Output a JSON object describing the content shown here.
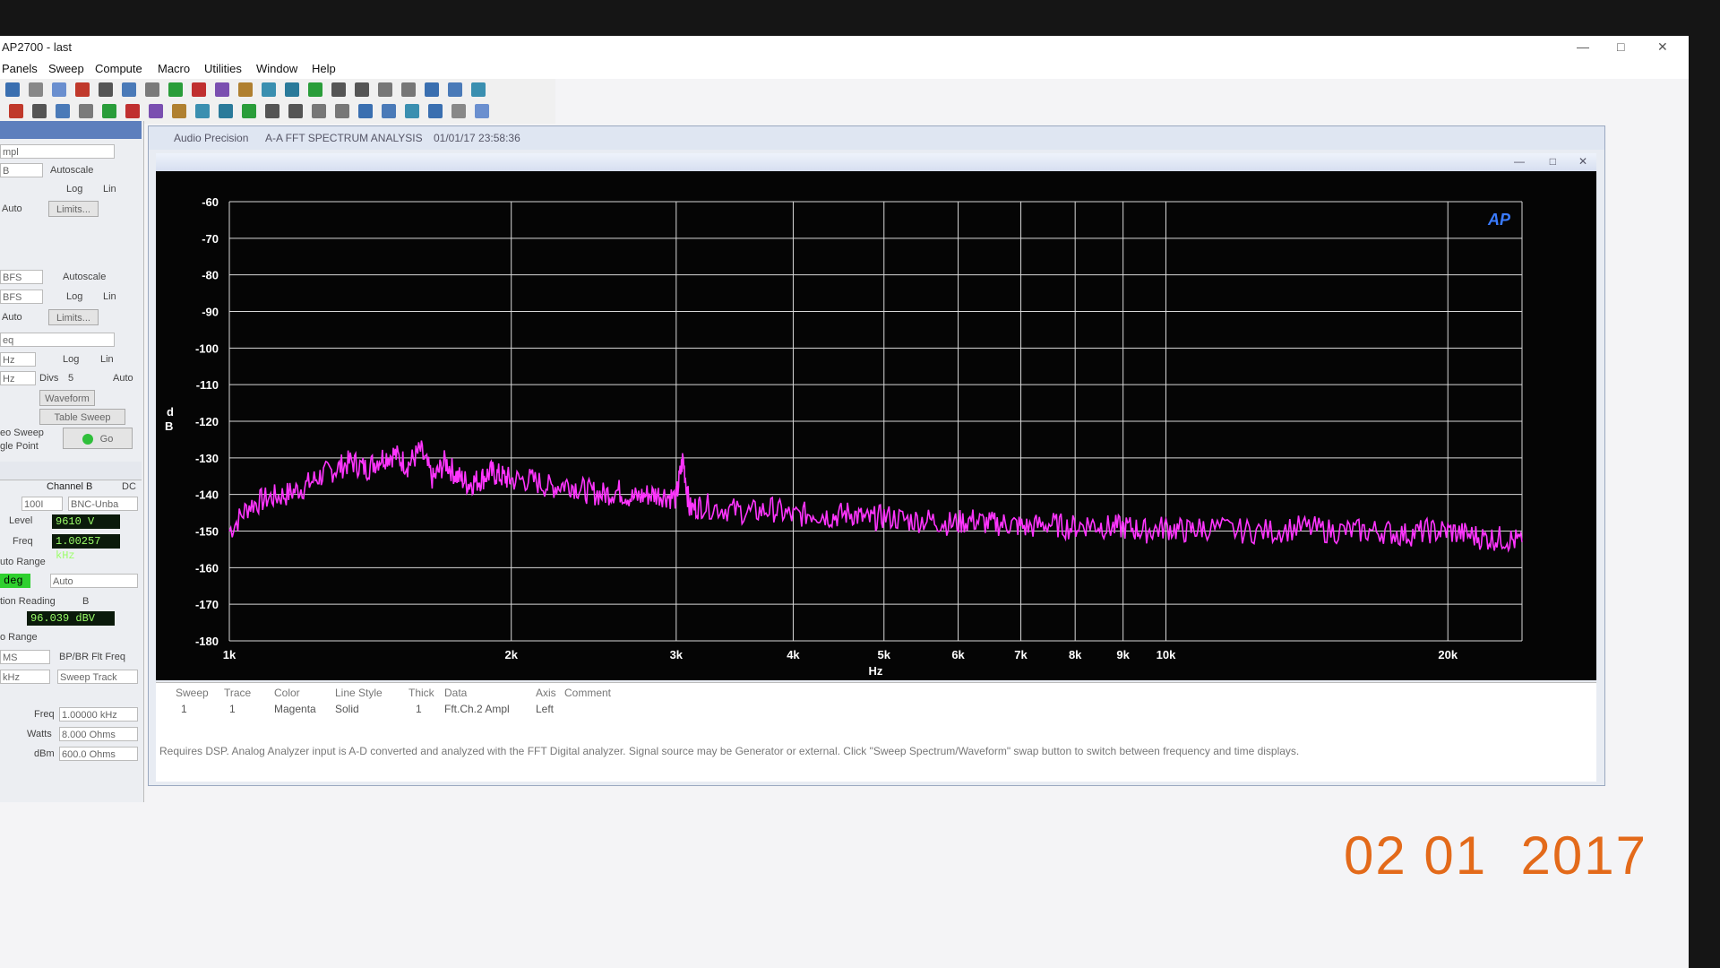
{
  "app": {
    "title": "AP2700 - last",
    "minimize": "—",
    "restore": "□",
    "close": "✕"
  },
  "menu": [
    "Panels",
    "Sweep",
    "Compute",
    "Macro",
    "Utilities",
    "Window",
    "Help"
  ],
  "toolbar_icons": [
    "open-icon",
    "print-icon",
    "print-preview-icon",
    "undo-icon",
    "cut-icon",
    "copy-icon",
    "paste-icon",
    "go-icon",
    "stop-icon",
    "settings-icon",
    "zoom-icon",
    "zoom-fit-icon",
    "refresh-icon",
    "play-icon",
    "pause-icon",
    "stop-square-icon",
    "hand-icon",
    "link-icon",
    "export-icon",
    "window-icon",
    "window2-icon"
  ],
  "left_panel": {
    "ampl": "mpl",
    "autoscale": "Autoscale",
    "unit1": "B",
    "log": "Log",
    "lin": "Lin",
    "auto": "Auto",
    "limits": "Limits...",
    "unit2": "BFS",
    "unit3": "BFS",
    "freq_field": "eq",
    "hz1": "Hz",
    "hz2": "Hz",
    "divs": "Divs",
    "divs_val": "5",
    "auto2": "Auto",
    "waveform": "Waveform",
    "table_sweep": "Table Sweep",
    "stereo_sweep": "eo Sweep",
    "single_point": "gle Point",
    "go": "Go",
    "channel_b": "Channel B",
    "dc": "DC",
    "range": "100I",
    "bnc": "BNC-Unba",
    "level_label": "Level",
    "level_val": "9610  V",
    "freq_label": "Freq",
    "freq_val": "1.00257 kHz",
    "auto_range": "uto Range",
    "deg_val": "deg",
    "auto3": "Auto",
    "function_reading": "tion Reading",
    "b": "B",
    "reading_val": "96.039  dBV",
    "o_range": "o Range",
    "ms": "MS",
    "bpbr": "BP/BR Flt Freq",
    "khz": "kHz",
    "sweep_track": "Sweep Track",
    "freq2_label": "Freq",
    "freq2_val": "1.00000 kHz",
    "watts_label": "Watts",
    "watts_val": "8.000   Ohms",
    "dbm_label": "dBm",
    "dbm_val": "600.0   Ohms"
  },
  "graph_window": {
    "title": "Audio Precision",
    "subtitle": "A-A FFT SPECTRUM ANALYSIS",
    "timestamp": "01/01/17 23:58:36",
    "logo": "AP"
  },
  "chart_data": {
    "type": "line",
    "title": "",
    "xlabel": "Hz",
    "ylabel": "dB",
    "xscale": "log",
    "xlim": [
      1000,
      24000
    ],
    "ylim": [
      -180,
      -60
    ],
    "grid": true,
    "x_ticks": [
      "1k",
      "2k",
      "3k",
      "4k",
      "5k",
      "6k",
      "7k",
      "8k",
      "9k",
      "10k",
      "20k"
    ],
    "y_ticks": [
      "-60",
      "-70",
      "-80",
      "-90",
      "-100",
      "-110",
      "-120",
      "-130",
      "-140",
      "-150",
      "-160",
      "-170",
      "-180"
    ],
    "series": [
      {
        "color": "#ff35ff",
        "x": [
          1000,
          1050,
          1100,
          1150,
          1200,
          1250,
          1300,
          1350,
          1400,
          1450,
          1500,
          1550,
          1600,
          1650,
          1700,
          1750,
          1800,
          1850,
          1900,
          1950,
          2000,
          2100,
          2200,
          2300,
          2400,
          2500,
          2600,
          2700,
          2800,
          2900,
          3000,
          3050,
          3100,
          3200,
          3400,
          3600,
          3800,
          4000,
          4200,
          4400,
          4600,
          4800,
          5000,
          5300,
          5600,
          5900,
          6200,
          6500,
          6800,
          7100,
          7500,
          7900,
          8300,
          8700,
          9100,
          9500,
          10000,
          10500,
          11000,
          12000,
          13000,
          14000,
          15000,
          16000,
          17000,
          18000,
          19000,
          20000,
          21000,
          22000,
          23000,
          24000
        ],
        "values": [
          -150,
          -143,
          -141,
          -140,
          -138,
          -135,
          -133,
          -131,
          -133,
          -130,
          -129,
          -132,
          -128,
          -136,
          -131,
          -135,
          -137,
          -136,
          -134,
          -135,
          -136,
          -136,
          -138,
          -137,
          -139,
          -140,
          -139,
          -141,
          -140,
          -140,
          -141,
          -130,
          -144,
          -143,
          -144,
          -145,
          -144,
          -146,
          -145,
          -146,
          -145,
          -147,
          -146,
          -147,
          -147,
          -148,
          -147,
          -148,
          -148,
          -149,
          -148,
          -149,
          -148,
          -149,
          -149,
          -150,
          -149,
          -150,
          -149,
          -150,
          -150,
          -149,
          -150,
          -150,
          -150,
          -151,
          -150,
          -150,
          -151,
          -152,
          -152,
          -153
        ]
      }
    ]
  },
  "legend": {
    "headers": [
      "Sweep",
      "Trace",
      "Color",
      "Line Style",
      "Thick",
      "Data",
      "Axis",
      "Comment"
    ],
    "row": [
      "1",
      "1",
      "Magenta",
      "Solid",
      "1",
      "Fft.Ch.2 Ampl",
      "Left",
      ""
    ],
    "description": "Requires DSP.  Analog Analyzer input is A-D converted and analyzed with the FFT Digital analyzer.  Signal source may be Generator or external.  Click \"Sweep Spectrum/Waveform\" swap button to switch between frequency and time displays."
  },
  "photo_date": "02 01  2017"
}
